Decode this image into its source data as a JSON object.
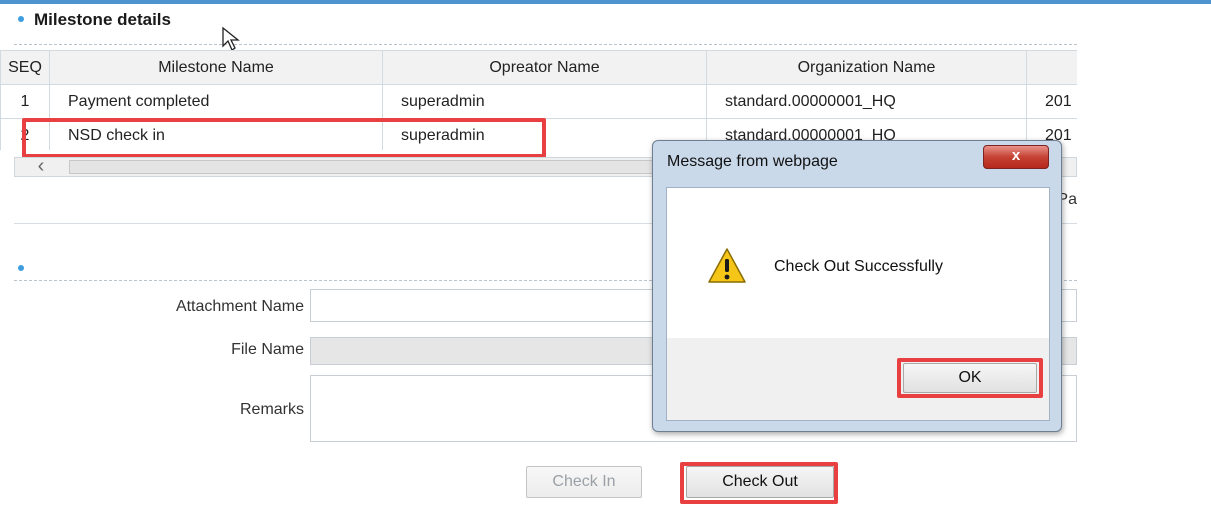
{
  "section": {
    "title": "Milestone details"
  },
  "grid": {
    "columns": [
      "SEQ",
      "Milestone Name",
      "Opreator Name",
      "Organization Name",
      ""
    ],
    "rows": [
      {
        "seq": "1",
        "milestone": "Payment completed",
        "operator": "superadmin",
        "org": "standard.00000001_HQ",
        "extra": "201"
      },
      {
        "seq": "2",
        "milestone": "NSD check in",
        "operator": "superadmin",
        "org": "standard.00000001_HQ",
        "extra": "201"
      }
    ],
    "pager_partial": "Pa"
  },
  "form": {
    "attachment_label": "Attachment Name",
    "file_label": "File Name",
    "remarks_label": "Remarks",
    "attachment_value": "",
    "file_value": "",
    "remarks_value": ""
  },
  "buttons": {
    "check_in": "Check In",
    "check_out": "Check Out"
  },
  "dialog": {
    "title": "Message from webpage",
    "close": "x",
    "message": "Check Out Successfully",
    "ok": "OK"
  },
  "colors": {
    "accent": "#4d94d0",
    "highlight": "#e84040",
    "dialog_frame": "#c9d9ea"
  }
}
